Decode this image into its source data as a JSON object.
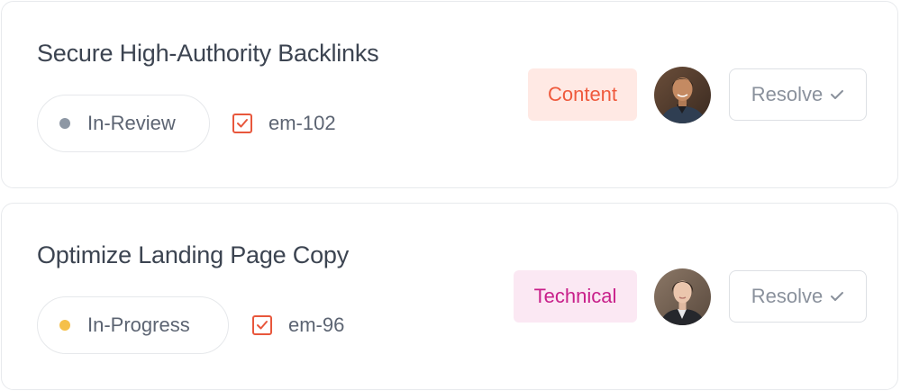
{
  "tasks": [
    {
      "title": "Secure High-Authority Backlinks",
      "status": "In-Review",
      "status_color": "#8d97a4",
      "id": "em-102",
      "tag": "Content",
      "tag_bg": "#ffe9e4",
      "tag_fg": "#ef5a3d",
      "resolve_label": "Resolve"
    },
    {
      "title": "Optimize Landing Page Copy",
      "status": "In-Progress",
      "status_color": "#f5c04a",
      "id": "em-96",
      "tag": "Technical",
      "tag_bg": "#fbe8f3",
      "tag_fg": "#c8208a",
      "resolve_label": "Resolve"
    }
  ]
}
